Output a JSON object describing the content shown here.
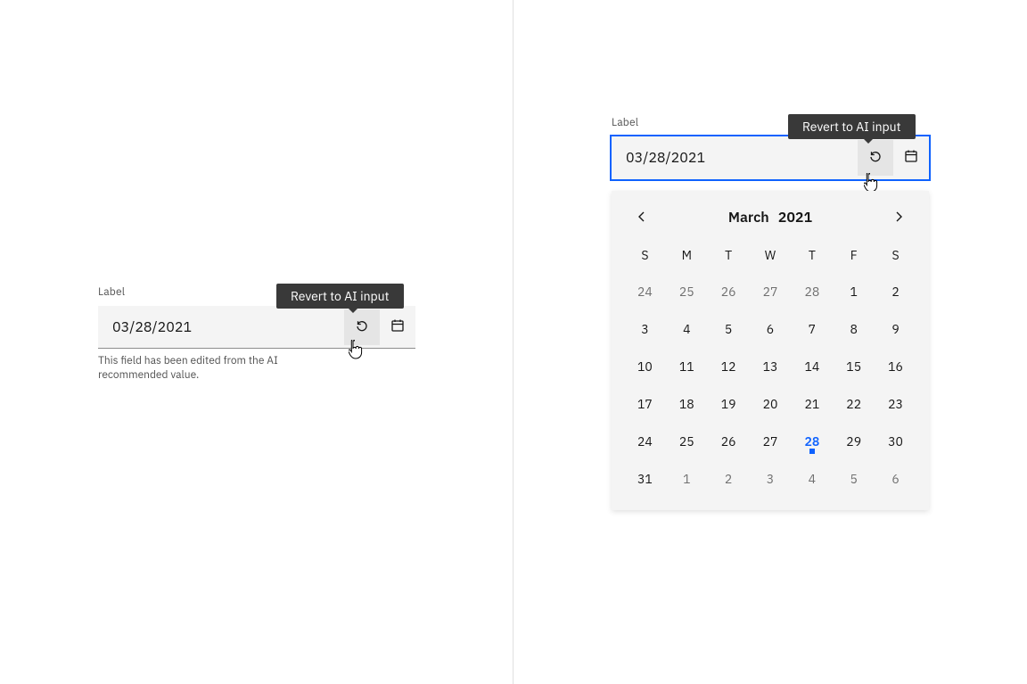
{
  "tooltip_text": "Revert to AI input",
  "left": {
    "label": "Label",
    "value": "03/28/2021",
    "helper": "This field has been edited from the AI recommended value."
  },
  "right": {
    "label": "Label",
    "value": "03/28/2021",
    "calendar": {
      "month": "March",
      "year": "2021",
      "weekdays": [
        "S",
        "M",
        "T",
        "W",
        "T",
        "F",
        "S"
      ],
      "days": [
        {
          "n": "24",
          "out": true
        },
        {
          "n": "25",
          "out": true
        },
        {
          "n": "26",
          "out": true
        },
        {
          "n": "27",
          "out": true
        },
        {
          "n": "28",
          "out": true
        },
        {
          "n": "1"
        },
        {
          "n": "2"
        },
        {
          "n": "3"
        },
        {
          "n": "4"
        },
        {
          "n": "5"
        },
        {
          "n": "6"
        },
        {
          "n": "7"
        },
        {
          "n": "8"
        },
        {
          "n": "9"
        },
        {
          "n": "10"
        },
        {
          "n": "11"
        },
        {
          "n": "12"
        },
        {
          "n": "13"
        },
        {
          "n": "14"
        },
        {
          "n": "15"
        },
        {
          "n": "16"
        },
        {
          "n": "17"
        },
        {
          "n": "18"
        },
        {
          "n": "19"
        },
        {
          "n": "20"
        },
        {
          "n": "21"
        },
        {
          "n": "22"
        },
        {
          "n": "23"
        },
        {
          "n": "24"
        },
        {
          "n": "25"
        },
        {
          "n": "26"
        },
        {
          "n": "27"
        },
        {
          "n": "28",
          "selected": true
        },
        {
          "n": "29"
        },
        {
          "n": "30"
        },
        {
          "n": "31"
        },
        {
          "n": "1",
          "out": true
        },
        {
          "n": "2",
          "out": true
        },
        {
          "n": "3",
          "out": true
        },
        {
          "n": "4",
          "out": true
        },
        {
          "n": "5",
          "out": true
        },
        {
          "n": "6",
          "out": true
        }
      ]
    }
  },
  "icons": {
    "revert": "undo-icon",
    "calendar": "calendar-icon",
    "prev": "chevron-left-icon",
    "next": "chevron-right-icon"
  },
  "colors": {
    "focus": "#0f62fe",
    "field_bg": "#f4f4f4",
    "tooltip_bg": "#393939",
    "text_secondary": "#525252",
    "text_muted": "#6f6f6f"
  }
}
